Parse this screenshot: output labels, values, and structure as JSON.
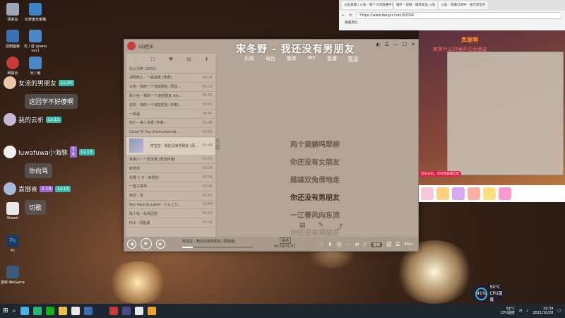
{
  "desktop_icons": [
    {
      "label": "回收站",
      "color": "#9aa8b8"
    },
    {
      "label": "仪表盘全家桶",
      "color": "#3b84c8"
    },
    {
      "label": "控制面板",
      "color": "#3a6fb0"
    },
    {
      "label": "天 / 音 (piano ver.)",
      "color": "#4a88c8"
    },
    {
      "label": "网易云",
      "color": "#c93b3b"
    },
    {
      "label": "光 / 雨",
      "color": "#4a88c8"
    },
    {
      "label": "Steam",
      "color": "#1b2838"
    },
    {
      "label": "Ps",
      "color": "#1f3a5a"
    },
    {
      "label": "游戏 WeGame",
      "color": "#3a5a7a"
    }
  ],
  "chat": [
    {
      "name": "女流的男朋友",
      "badge": "Lv.20",
      "msg": "这回学不好傻啊"
    },
    {
      "name": "我的云析",
      "badge": "Lv.13",
      "msg": ""
    },
    {
      "name": "luwafuwa小海豚",
      "badge": "Lv.13",
      "badge2": "5 9",
      "msg": "你向骂"
    },
    {
      "name": "直御喜",
      "badge": "Lv.14",
      "badge2": "5 19",
      "msg": "切歌"
    }
  ],
  "music": {
    "app_name": "QQ音乐",
    "big_title": "宋冬野 - 我还没有男朋友",
    "search_placeholder": "搜索",
    "nav": [
      "乐库",
      "电台",
      "歌单",
      "MV",
      "直播",
      "歌词"
    ],
    "tools": [
      "♫",
      "☐",
      "♥",
      "▤",
      "⬇"
    ],
    "list_header": "默认列表 (2582)",
    "songs": [
      {
        "title": "清明雨上 - 一曲温柔 (伴奏)",
        "dur": "04:16"
      },
      {
        "title": "以朱 - 我的一个道姑朋友 (原创...",
        "dur": "05:13"
      },
      {
        "title": "陈小怡 - 我的一个道姑朋友 (Ve...",
        "dur": "05:05"
      },
      {
        "title": "墨安 - 我的一个道姑朋友 (伴奏)",
        "dur": "04:47"
      },
      {
        "title": "一曲温",
        "dur": "04:47"
      },
      {
        "title": "倪小 - 美人关霞 (伴奏)",
        "dur": "03:49"
      },
      {
        "title": "Close To You (Instrumental ...",
        "dur": "03:05"
      },
      {
        "title": "咩宝宝 - 我还没有男朋友 (原...",
        "dur": "02:44",
        "current": true,
        "sub": "00:01/01:01"
      },
      {
        "title": "百歌川 - 一枕清宵 (原创伴奏)",
        "dur": "03:21"
      },
      {
        "title": "新惯创",
        "dur": "03:34"
      },
      {
        "title": "松豫 C 子 - 新惯创",
        "dur": "03:36"
      },
      {
        "title": "一首子故单",
        "dur": "03:44"
      },
      {
        "title": "夜空 - 音",
        "dur": "01:43"
      },
      {
        "title": "Key Sounds Label - たんごた...",
        "dur": "03:54"
      },
      {
        "title": "陈小怡 - 乱世回流",
        "dur": "05:03"
      },
      {
        "title": "FLA - 洞庭湖",
        "dur": "03:25"
      }
    ],
    "lyrics": [
      {
        "text": "两个黄鹂鸣翠柳",
        "state": "normal"
      },
      {
        "text": "你还没有女朋友",
        "state": "normal"
      },
      {
        "text": "雌雄双兔傍地走",
        "state": "normal"
      },
      {
        "text": "你还没有男朋友",
        "state": "active"
      },
      {
        "text": "一江春风向东流",
        "state": "normal"
      },
      {
        "text": "你还没有男朋友",
        "state": "faded"
      }
    ],
    "now_playing": "咩宝宝 - 我还没有男朋友 (原唱版)",
    "time": "00:02/01:01",
    "progress_pct": 15,
    "quality": "极高",
    "play_count": "999+",
    "vip": "音效"
  },
  "browser": {
    "tabs": [
      "斗鱼直播 | 斗鱼 - 每个人的直播平台",
      "铺子 - 官网 - 推荐新品 斗鱼",
      "斗鱼 - 直播订阅中 - 张艺星官方"
    ],
    "url": "https://www.douyu.com/52004",
    "bookmarks": "收藏夹栏"
  },
  "stream": {
    "title": "真敢啊",
    "subtitle": "笑笑什么时候开动女朋友",
    "promo": "音乐分类，可有连直播互动"
  },
  "cpu": {
    "percent": "41%",
    "temp": "59°C",
    "label": "CPU温度"
  },
  "taskbar": {
    "time": "19:39",
    "date": "2021/10/28",
    "temp": "59°C",
    "weather": "CPU温度"
  }
}
